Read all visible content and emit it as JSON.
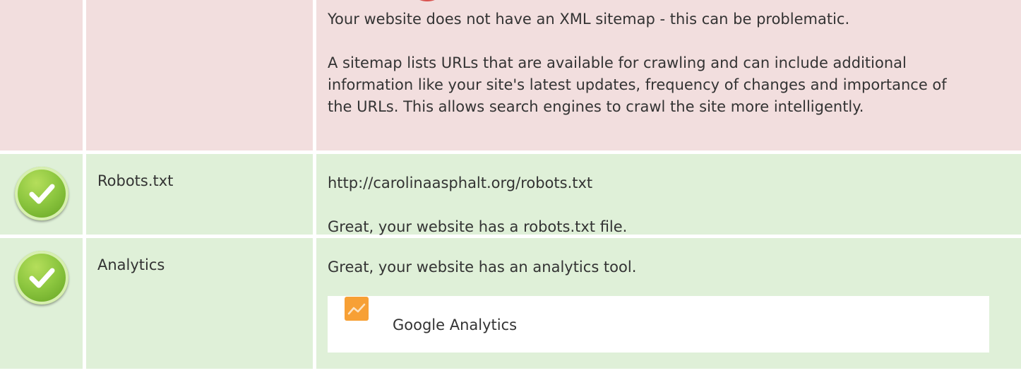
{
  "rows": [
    {
      "status": "error",
      "name": "",
      "lines": [
        "Your website does not have an XML sitemap - this can be problematic.",
        "A sitemap lists URLs that are available for crawling and can include additional information like your site's latest updates, frequency of changes and importance of the URLs. This allows search engines to crawl the site more intelligently."
      ]
    },
    {
      "status": "success",
      "name": "Robots.txt",
      "lines": [
        "http://carolinaasphalt.org/robots.txt",
        "Great, your website has a robots.txt file."
      ]
    },
    {
      "status": "success",
      "name": "Analytics",
      "lines": [
        "Great, your website has an analytics tool."
      ],
      "tool": {
        "label": "Google Analytics",
        "icon": "google-analytics-icon"
      }
    }
  ],
  "colors": {
    "error_bg": "#f2dede",
    "success_bg": "#dff0d8",
    "error_icon": "#d9534f",
    "success_icon": "#8cc63f",
    "analytics_icon": "#f7a035"
  }
}
